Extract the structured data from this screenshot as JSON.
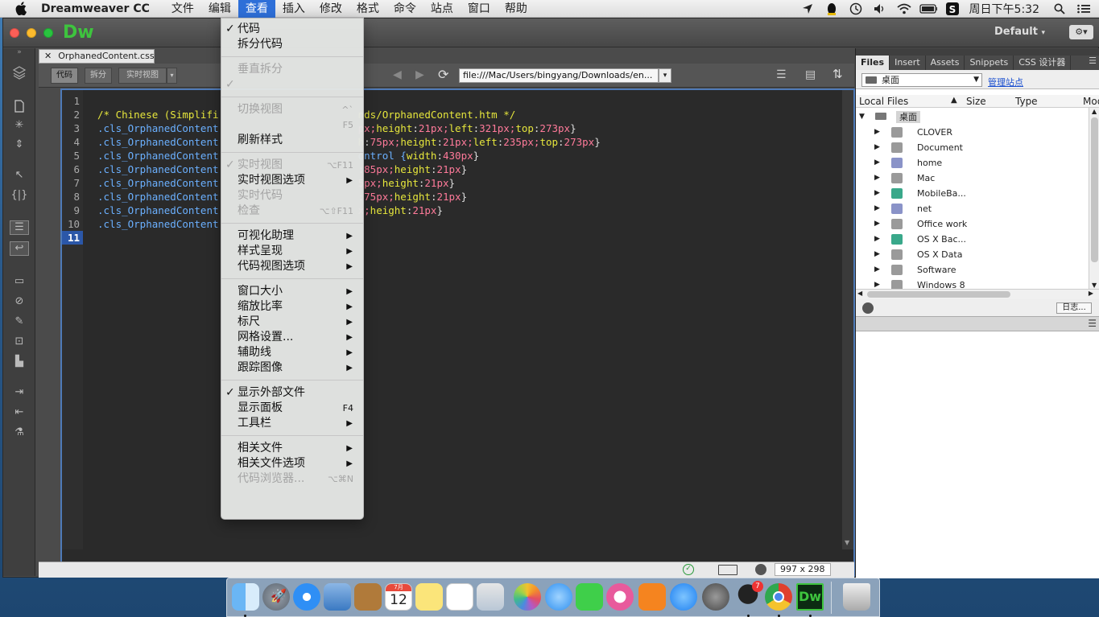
{
  "menubar": {
    "app_name": "Dreamweaver CC",
    "items": [
      "文件",
      "编辑",
      "查看",
      "插入",
      "修改",
      "格式",
      "命令",
      "站点",
      "窗口",
      "帮助"
    ],
    "clock": "周日下午5:32"
  },
  "window": {
    "logo": "Dw",
    "workspace": "Default",
    "doc_tab": "OrphanedContent.css",
    "view_buttons": [
      "代码",
      "拆分",
      "实时视图"
    ],
    "url": "file:///Mac/Users/bingyang/Downloads/en...",
    "status_size": "997 x 298"
  },
  "code": {
    "line_numbers": [
      "1",
      "2",
      "3",
      "4",
      "5",
      "6",
      "7",
      "8",
      "9",
      "10",
      "11"
    ],
    "lines": [
      [],
      [
        {
          "t": "/* Chinese (Simplifi",
          "c": "c-com"
        },
        {
          "t": "                       ",
          "c": "c-plain"
        },
        {
          "t": "nds/OrphanedContent.htm */",
          "c": "c-com"
        }
      ],
      [
        {
          "t": ".cls_OrphanedContent",
          "c": "c-sel"
        },
        {
          "t": "                       ",
          "c": "c-plain"
        },
        {
          "t": "px;",
          "c": "c-val"
        },
        {
          "t": "height",
          "c": "c-prop"
        },
        {
          "t": ":",
          "c": "c-plain"
        },
        {
          "t": "21px;",
          "c": "c-val"
        },
        {
          "t": "left",
          "c": "c-prop"
        },
        {
          "t": ":",
          "c": "c-plain"
        },
        {
          "t": "321px;",
          "c": "c-val"
        },
        {
          "t": "top",
          "c": "c-prop"
        },
        {
          "t": ":",
          "c": "c-plain"
        },
        {
          "t": "273px",
          "c": "c-val"
        },
        {
          "t": "}",
          "c": "c-plain"
        }
      ],
      [
        {
          "t": ".cls_OrphanedContent",
          "c": "c-sel"
        },
        {
          "t": "                       ",
          "c": "c-plain"
        },
        {
          "t": "h",
          "c": "c-prop"
        },
        {
          "t": ":",
          "c": "c-plain"
        },
        {
          "t": "75px;",
          "c": "c-val"
        },
        {
          "t": "height",
          "c": "c-prop"
        },
        {
          "t": ":",
          "c": "c-plain"
        },
        {
          "t": "21px;",
          "c": "c-val"
        },
        {
          "t": "left",
          "c": "c-prop"
        },
        {
          "t": ":",
          "c": "c-plain"
        },
        {
          "t": "235px;",
          "c": "c-val"
        },
        {
          "t": "top",
          "c": "c-prop"
        },
        {
          "t": ":",
          "c": "c-plain"
        },
        {
          "t": "273px",
          "c": "c-val"
        },
        {
          "t": "}",
          "c": "c-plain"
        }
      ],
      [
        {
          "t": ".cls_OrphanedContent",
          "c": "c-sel"
        },
        {
          "t": "                       ",
          "c": "c-plain"
        },
        {
          "t": "ontrol {",
          "c": "c-sel"
        },
        {
          "t": "width",
          "c": "c-prop"
        },
        {
          "t": ":",
          "c": "c-plain"
        },
        {
          "t": "430px",
          "c": "c-val"
        },
        {
          "t": "}",
          "c": "c-plain"
        }
      ],
      [
        {
          "t": ".cls_OrphanedContent",
          "c": "c-sel"
        },
        {
          "t": "                       ",
          "c": "c-plain"
        },
        {
          "t": ":",
          "c": "c-plain"
        },
        {
          "t": "85px;",
          "c": "c-val"
        },
        {
          "t": "height",
          "c": "c-prop"
        },
        {
          "t": ":",
          "c": "c-plain"
        },
        {
          "t": "21px",
          "c": "c-val"
        },
        {
          "t": "}",
          "c": "c-plain"
        }
      ],
      [
        {
          "t": ".cls_OrphanedContent",
          "c": "c-sel"
        },
        {
          "t": "                       ",
          "c": "c-plain"
        },
        {
          "t": "5px;",
          "c": "c-val"
        },
        {
          "t": "height",
          "c": "c-prop"
        },
        {
          "t": ":",
          "c": "c-plain"
        },
        {
          "t": "21px",
          "c": "c-val"
        },
        {
          "t": "}",
          "c": "c-plain"
        }
      ],
      [
        {
          "t": ".cls_OrphanedContent",
          "c": "c-sel"
        },
        {
          "t": "                       ",
          "c": "c-plain"
        },
        {
          "t": ":",
          "c": "c-plain"
        },
        {
          "t": "75px;",
          "c": "c-val"
        },
        {
          "t": "height",
          "c": "c-prop"
        },
        {
          "t": ":",
          "c": "c-plain"
        },
        {
          "t": "21px",
          "c": "c-val"
        },
        {
          "t": "}",
          "c": "c-plain"
        }
      ],
      [
        {
          "t": ".cls_OrphanedContent",
          "c": "c-sel"
        },
        {
          "t": "                       ",
          "c": "c-plain"
        },
        {
          "t": "x;",
          "c": "c-val"
        },
        {
          "t": "height",
          "c": "c-prop"
        },
        {
          "t": ":",
          "c": "c-plain"
        },
        {
          "t": "21px",
          "c": "c-val"
        },
        {
          "t": "}",
          "c": "c-plain"
        }
      ],
      [
        {
          "t": ".cls_OrphanedContent",
          "c": "c-sel"
        }
      ],
      []
    ]
  },
  "view_menu": {
    "items": [
      {
        "label": "代码",
        "checked": true,
        "disabled": false,
        "shortcut": "",
        "submenu": false
      },
      {
        "label": "拆分代码",
        "checked": false,
        "disabled": false,
        "shortcut": "",
        "submenu": false
      },
      {
        "sep": true
      },
      {
        "label": "垂直拆分",
        "checked": false,
        "disabled": true,
        "shortcut": "",
        "submenu": false
      },
      {
        "label": "",
        "checked": true,
        "disabled": true,
        "shortcut": "",
        "submenu": false
      },
      {
        "sep": true
      },
      {
        "label": "切换视图",
        "checked": false,
        "disabled": true,
        "shortcut": "^`",
        "submenu": false
      },
      {
        "label": "",
        "checked": false,
        "disabled": true,
        "shortcut": "F5",
        "submenu": false
      },
      {
        "label": "刷新样式",
        "checked": false,
        "disabled": false,
        "shortcut": "",
        "submenu": false
      },
      {
        "sep": true
      },
      {
        "label": "实时视图",
        "checked": true,
        "disabled": true,
        "shortcut": "⌥F11",
        "submenu": false
      },
      {
        "label": "实时视图选项",
        "checked": false,
        "disabled": false,
        "shortcut": "",
        "submenu": true
      },
      {
        "label": "实时代码",
        "checked": false,
        "disabled": true,
        "shortcut": "",
        "submenu": false
      },
      {
        "label": "检查",
        "checked": false,
        "disabled": true,
        "shortcut": "⌥⇧F11",
        "submenu": false
      },
      {
        "sep": true
      },
      {
        "label": "可视化助理",
        "checked": false,
        "disabled": false,
        "shortcut": "",
        "submenu": true
      },
      {
        "label": "样式呈现",
        "checked": false,
        "disabled": false,
        "shortcut": "",
        "submenu": true
      },
      {
        "label": "代码视图选项",
        "checked": false,
        "disabled": false,
        "shortcut": "",
        "submenu": true
      },
      {
        "sep": true
      },
      {
        "label": "窗口大小",
        "checked": false,
        "disabled": false,
        "shortcut": "",
        "submenu": true
      },
      {
        "label": "缩放比率",
        "checked": false,
        "disabled": false,
        "shortcut": "",
        "submenu": true
      },
      {
        "label": "标尺",
        "checked": false,
        "disabled": false,
        "shortcut": "",
        "submenu": true
      },
      {
        "label": "网格设置...",
        "checked": false,
        "disabled": false,
        "shortcut": "",
        "submenu": true
      },
      {
        "label": "辅助线",
        "checked": false,
        "disabled": false,
        "shortcut": "",
        "submenu": true
      },
      {
        "label": "跟踪图像",
        "checked": false,
        "disabled": false,
        "shortcut": "",
        "submenu": true
      },
      {
        "sep": true
      },
      {
        "label": "显示外部文件",
        "checked": true,
        "disabled": false,
        "shortcut": "",
        "submenu": false
      },
      {
        "label": "显示面板",
        "checked": false,
        "disabled": false,
        "shortcut": "F4",
        "submenu": false
      },
      {
        "label": "工具栏",
        "checked": false,
        "disabled": false,
        "shortcut": "",
        "submenu": true
      },
      {
        "sep": true
      },
      {
        "label": "相关文件",
        "checked": false,
        "disabled": false,
        "shortcut": "",
        "submenu": true
      },
      {
        "label": "相关文件选项",
        "checked": false,
        "disabled": false,
        "shortcut": "",
        "submenu": true
      },
      {
        "label": "代码浏览器...",
        "checked": false,
        "disabled": true,
        "shortcut": "⌥⌘N",
        "submenu": false
      }
    ]
  },
  "files_panel": {
    "tabs": [
      "Files",
      "Insert",
      "Assets",
      "Snippets",
      "CSS 设计器"
    ],
    "site": "桌面",
    "manage_link": "管理站点",
    "columns": [
      "Local Files",
      "Size",
      "Type",
      "Mod"
    ],
    "root": "桌面",
    "entries": [
      {
        "name": "CLOVER",
        "color": "#9a9a9a"
      },
      {
        "name": "Document",
        "color": "#9a9a9a"
      },
      {
        "name": "home",
        "color": "#8a93c8"
      },
      {
        "name": "Mac",
        "color": "#9a9a9a"
      },
      {
        "name": "MobileBa...",
        "color": "#39a88a"
      },
      {
        "name": "net",
        "color": "#8a93c8"
      },
      {
        "name": "Office work",
        "color": "#9a9a9a"
      },
      {
        "name": "OS X Bac...",
        "color": "#39a88a"
      },
      {
        "name": "OS X Data",
        "color": "#9a9a9a"
      },
      {
        "name": "Software",
        "color": "#9a9a9a"
      },
      {
        "name": "Windows 8",
        "color": "#9a9a9a"
      }
    ],
    "log_button": "日志..."
  },
  "dock": {
    "calendar_month": "7月",
    "calendar_day": "12",
    "qq_badge": "7",
    "dw_label": "Dw",
    "apps": [
      "finder-icon",
      "launchpad-icon",
      "safari-icon",
      "preview-icon",
      "contacts-icon",
      "calendar-icon",
      "notes-icon",
      "reminders-icon",
      "photo-booth-icon",
      "photos-icon",
      "messages-icon",
      "facetime-icon",
      "itunes-icon",
      "ibooks-icon",
      "app-store-icon",
      "system-preferences-icon",
      "qq-icon",
      "chrome-icon",
      "dreamweaver-icon",
      "trash-icon"
    ]
  }
}
